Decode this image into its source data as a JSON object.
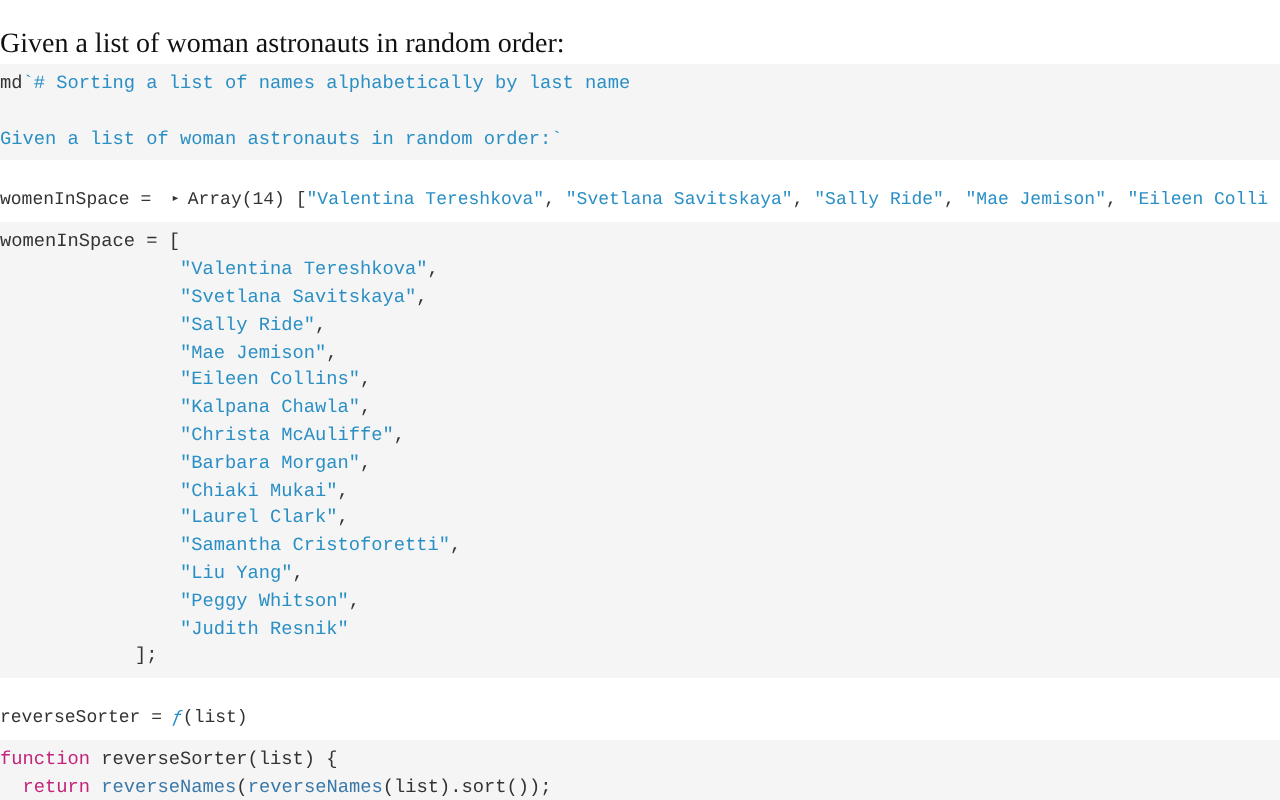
{
  "blocks": [
    {
      "kind": "markdown",
      "text": "Given a list of woman astronauts in random order:"
    },
    {
      "kind": "code",
      "tokens": [
        {
          "kind": "plain",
          "text": "md"
        },
        {
          "kind": "string",
          "text": "`# Sorting a list of names alphabetically by last name\n\nGiven a list of woman astronauts in random order:`"
        }
      ]
    },
    {
      "kind": "value",
      "name": "womenInSpace =",
      "toggle": "▸",
      "tokens": [
        {
          "kind": "plain",
          "text": "Array(14) ["
        },
        {
          "kind": "string",
          "text": "\"Valentina Tereshkova\""
        },
        {
          "kind": "plain",
          "text": ", "
        },
        {
          "kind": "string",
          "text": "\"Svetlana Savitskaya\""
        },
        {
          "kind": "plain",
          "text": ", "
        },
        {
          "kind": "string",
          "text": "\"Sally Ride\""
        },
        {
          "kind": "plain",
          "text": ", "
        },
        {
          "kind": "string",
          "text": "\"Mae Jemison\""
        },
        {
          "kind": "plain",
          "text": ", "
        },
        {
          "kind": "string",
          "text": "\"Eileen Colli"
        }
      ]
    },
    {
      "kind": "code",
      "tokens": [
        {
          "kind": "plain",
          "text": "womenInSpace = [\n                "
        },
        {
          "kind": "string",
          "text": "\"Valentina Tereshkova\""
        },
        {
          "kind": "plain",
          "text": ",\n                "
        },
        {
          "kind": "string",
          "text": "\"Svetlana Savitskaya\""
        },
        {
          "kind": "plain",
          "text": ",\n                "
        },
        {
          "kind": "string",
          "text": "\"Sally Ride\""
        },
        {
          "kind": "plain",
          "text": ",\n                "
        },
        {
          "kind": "string",
          "text": "\"Mae Jemison\""
        },
        {
          "kind": "plain",
          "text": ",\n                "
        },
        {
          "kind": "string",
          "text": "\"Eileen Collins\""
        },
        {
          "kind": "plain",
          "text": ",\n                "
        },
        {
          "kind": "string",
          "text": "\"Kalpana Chawla\""
        },
        {
          "kind": "plain",
          "text": ",\n                "
        },
        {
          "kind": "string",
          "text": "\"Christa McAuliffe\""
        },
        {
          "kind": "plain",
          "text": ",\n                "
        },
        {
          "kind": "string",
          "text": "\"Barbara Morgan\""
        },
        {
          "kind": "plain",
          "text": ",\n                "
        },
        {
          "kind": "string",
          "text": "\"Chiaki Mukai\""
        },
        {
          "kind": "plain",
          "text": ",\n                "
        },
        {
          "kind": "string",
          "text": "\"Laurel Clark\""
        },
        {
          "kind": "plain",
          "text": ",\n                "
        },
        {
          "kind": "string",
          "text": "\"Samantha Cristoforetti\""
        },
        {
          "kind": "plain",
          "text": ",\n                "
        },
        {
          "kind": "string",
          "text": "\"Liu Yang\""
        },
        {
          "kind": "plain",
          "text": ",\n                "
        },
        {
          "kind": "string",
          "text": "\"Peggy Whitson\""
        },
        {
          "kind": "plain",
          "text": ",\n                "
        },
        {
          "kind": "string",
          "text": "\"Judith Resnik\""
        },
        {
          "kind": "plain",
          "text": "\n            ];"
        }
      ]
    },
    {
      "kind": "value",
      "name": "reverseSorter =",
      "tokens": [
        {
          "kind": "fn",
          "text": "ƒ"
        },
        {
          "kind": "plain",
          "text": "(list)"
        }
      ]
    },
    {
      "kind": "code",
      "tokens": [
        {
          "kind": "keyword",
          "text": "function"
        },
        {
          "kind": "plain",
          "text": " reverseSorter(list) {\n  "
        },
        {
          "kind": "keyword",
          "text": "return"
        },
        {
          "kind": "call",
          "text": " reverseNames"
        },
        {
          "kind": "plain",
          "text": "("
        },
        {
          "kind": "call",
          "text": "reverseNames"
        },
        {
          "kind": "plain",
          "text": "(list).sort());"
        }
      ]
    }
  ]
}
